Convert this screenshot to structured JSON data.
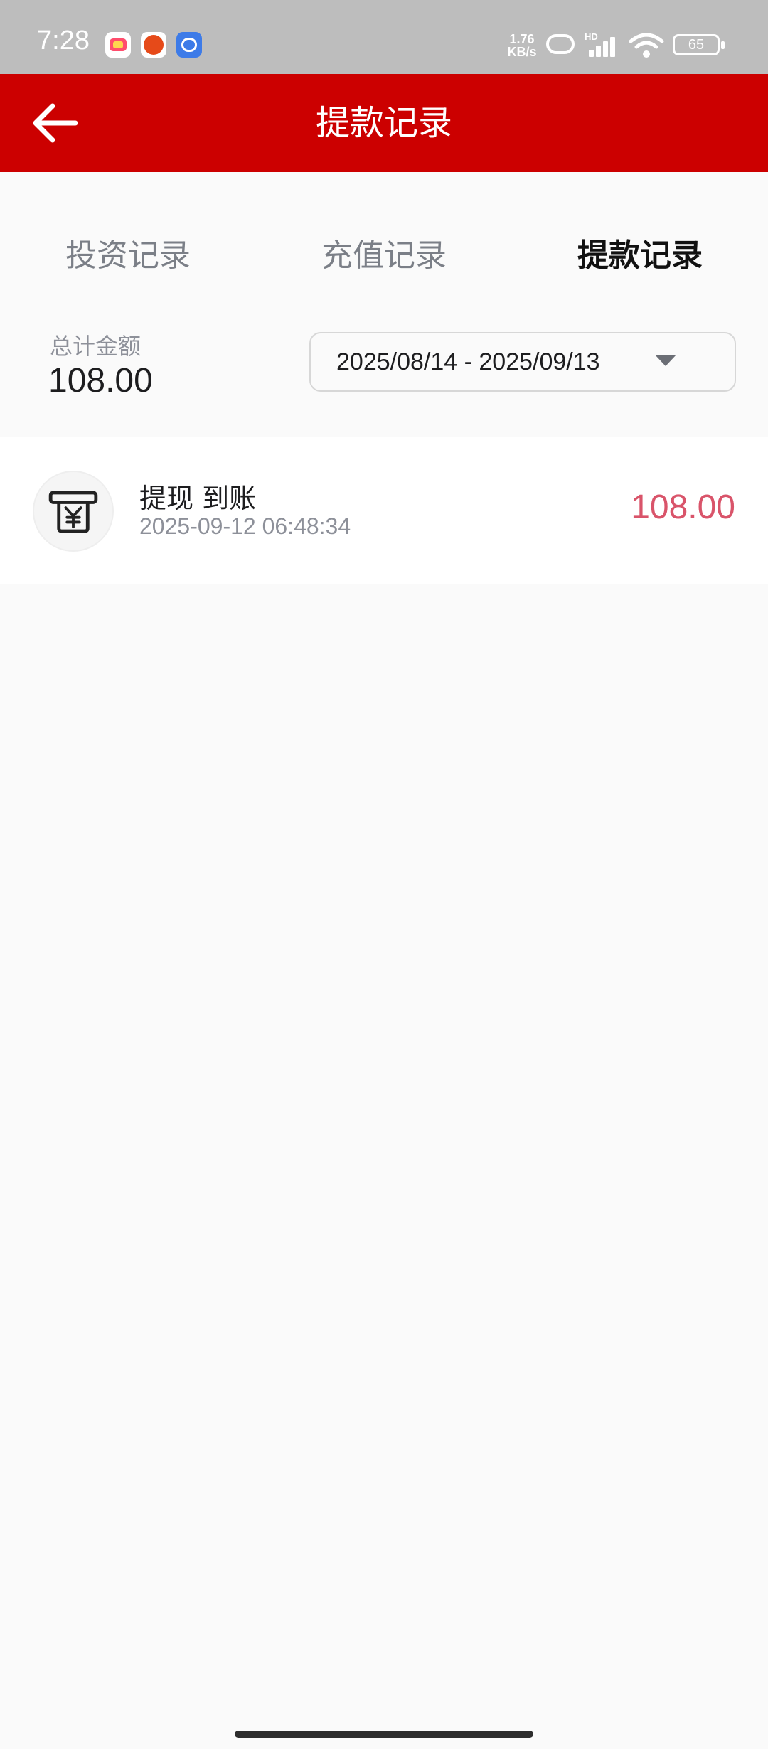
{
  "status_bar": {
    "time": "7:28",
    "net_speed_top": "1.76",
    "net_speed_bottom": "KB/s",
    "hd_label": "HD",
    "battery": "65",
    "icons": [
      "app-icon-1",
      "app-icon-2",
      "app-icon-3",
      "link-icon",
      "signal-icon",
      "wifi-icon",
      "battery-icon"
    ]
  },
  "header": {
    "title": "提款记录",
    "back_icon": "arrow-left-icon",
    "color": "#cc0000"
  },
  "tabs": [
    {
      "label": "投资记录",
      "active": false
    },
    {
      "label": "充值记录",
      "active": false
    },
    {
      "label": "提款记录",
      "active": true
    }
  ],
  "summary": {
    "label": "总计金额",
    "value": "108.00"
  },
  "date_filter": {
    "value": "2025/08/14 - 2025/09/13",
    "icon": "caret-down-icon"
  },
  "records": [
    {
      "icon": "atm-yen-icon",
      "title": "提现 到账",
      "time": "2025-09-12 06:48:34",
      "amount": "108.00",
      "amount_color": "#d9546a"
    }
  ]
}
